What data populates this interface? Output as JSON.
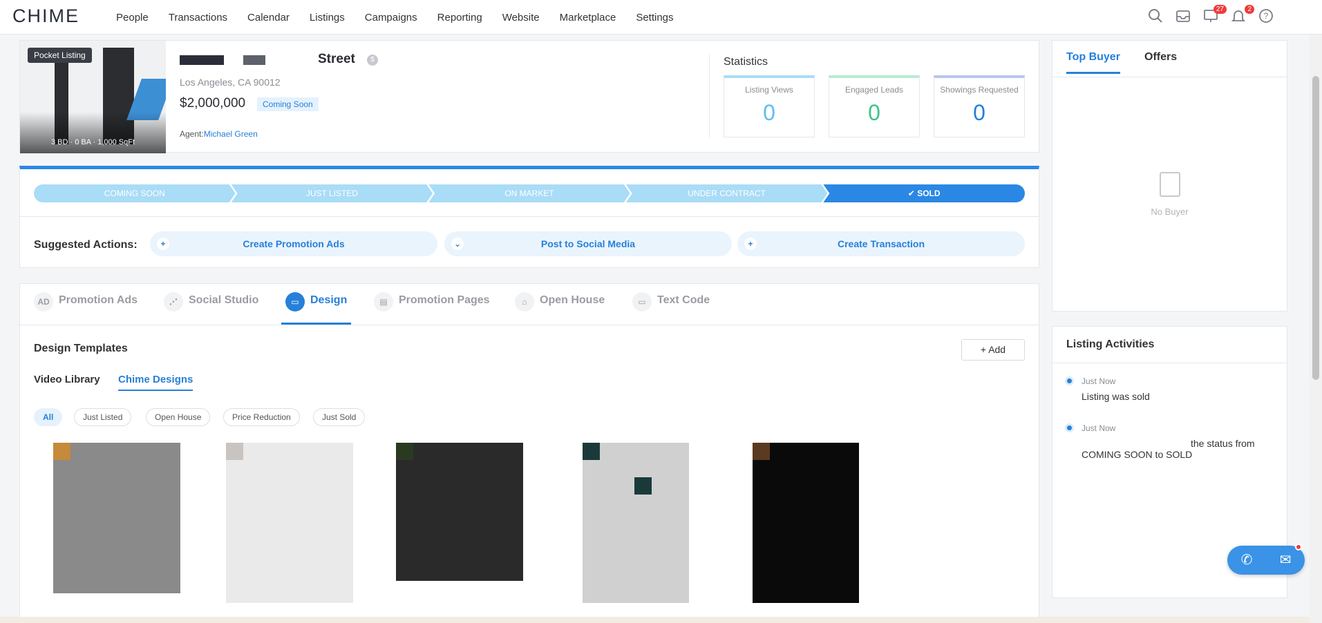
{
  "app": {
    "logo": "CHIME"
  },
  "nav": {
    "items": [
      "People",
      "Transactions",
      "Calendar",
      "Listings",
      "Campaigns",
      "Reporting",
      "Website",
      "Marketplace",
      "Settings"
    ],
    "icons": [
      "search-icon",
      "inbox-icon",
      "tasks-icon",
      "bell-icon",
      "help-icon"
    ],
    "badges": {
      "tasks": "27",
      "notifications": "2"
    }
  },
  "listing": {
    "badge": "Pocket Listing",
    "specs": "3 BD · 0 BA · 1,000 SqFt",
    "street": "Street",
    "city": "Los Angeles, CA 90012",
    "price": "$2,000,000",
    "status": "Coming Soon",
    "agent_label": "Agent:",
    "agent_name": "Michael Green"
  },
  "statistics": {
    "title": "Statistics",
    "items": [
      {
        "label": "Listing Views",
        "value": "0",
        "color": "#5bbef0"
      },
      {
        "label": "Engaged Leads",
        "value": "0",
        "color": "#3cc48a"
      },
      {
        "label": "Showings Requested",
        "value": "0",
        "color": "#2680d9"
      }
    ]
  },
  "pipeline": {
    "stages": [
      "COMING SOON",
      "JUST LISTED",
      "ON MARKET",
      "UNDER CONTRACT",
      "SOLD"
    ],
    "current": "SOLD"
  },
  "suggested": {
    "label": "Suggested Actions:",
    "actions": [
      {
        "label": "Create Promotion Ads",
        "icon": "+"
      },
      {
        "label": "Post to Social Media",
        "icon": "⌄"
      },
      {
        "label": "Create Transaction",
        "icon": "+"
      }
    ]
  },
  "tabs": {
    "items": [
      {
        "label": "Promotion Ads",
        "icon": "AD"
      },
      {
        "label": "Social Studio",
        "icon": "⋰"
      },
      {
        "label": "Design",
        "icon": "▭"
      },
      {
        "label": "Promotion Pages",
        "icon": "▤"
      },
      {
        "label": "Open House",
        "icon": "⌂"
      },
      {
        "label": "Text Code",
        "icon": "▭"
      }
    ],
    "active": "Design"
  },
  "design": {
    "title": "Design Templates",
    "add_label": "Add",
    "subtabs": [
      "Video Library",
      "Chime Designs"
    ],
    "active_subtab": "Chime Designs",
    "filters": [
      "All",
      "Just Listed",
      "Open House",
      "Price Reduction",
      "Just Sold"
    ],
    "active_filter": "All"
  },
  "right": {
    "tabs": [
      "Top Buyer",
      "Offers"
    ],
    "active_tab": "Top Buyer",
    "empty": "No Buyer",
    "activities_title": "Listing Activities",
    "activities": [
      {
        "time": "Just Now",
        "text": "Listing was sold"
      },
      {
        "time": "Just Now",
        "text_a": "the status from",
        "text_b": "COMING SOON to SOLD"
      }
    ]
  }
}
